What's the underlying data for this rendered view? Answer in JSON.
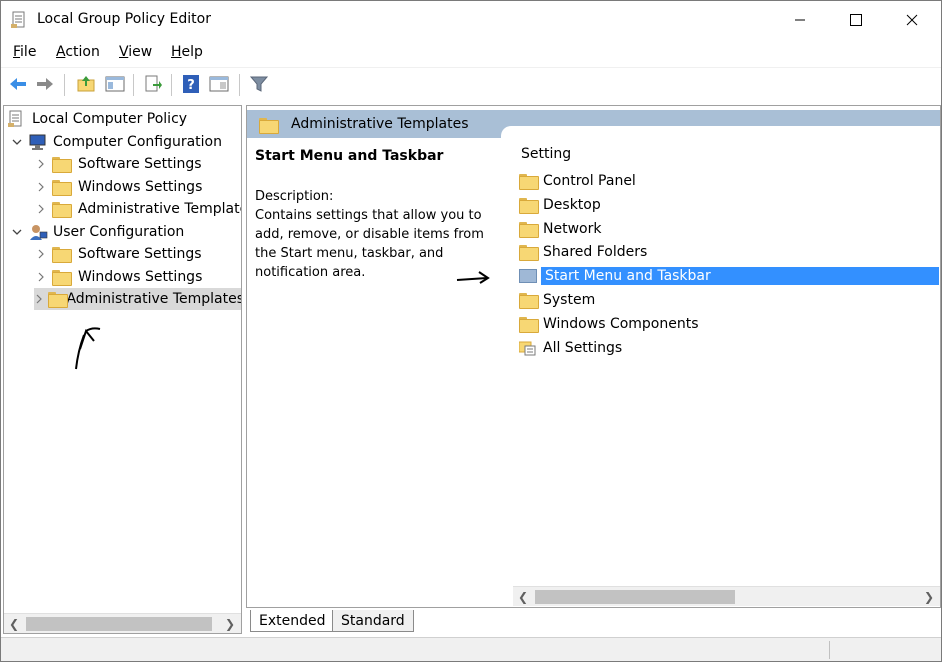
{
  "window": {
    "title": "Local Group Policy Editor",
    "icon": "policy-document-icon"
  },
  "menu": [
    {
      "label": "File"
    },
    {
      "label": "Action"
    },
    {
      "label": "View"
    },
    {
      "label": "Help"
    }
  ],
  "toolbar": {
    "buttons": [
      "back-arrow-icon",
      "forward-arrow-icon",
      "up-folder-icon",
      "show-hide-tree-icon",
      "export-list-icon",
      "help-icon",
      "extended-view-icon",
      "filter-icon"
    ]
  },
  "tree": {
    "root": "Local Computer Policy",
    "computer_config": "Computer Configuration",
    "cc_software": "Software Settings",
    "cc_windows": "Windows Settings",
    "cc_admin": "Administrative Templates",
    "user_config": "User Configuration",
    "uc_software": "Software Settings",
    "uc_windows": "Windows Settings",
    "uc_admin": "Administrative Templates"
  },
  "right": {
    "header_title": "Administrative Templates",
    "selected_title": "Start Menu and Taskbar",
    "description_label": "Description:",
    "description_body": "Contains settings that allow you to add, remove, or disable items from the Start menu, taskbar, and notification area.",
    "column_header": "Setting",
    "settings": [
      "Control Panel",
      "Desktop",
      "Network",
      "Shared Folders",
      "Start Menu and Taskbar",
      "System",
      "Windows Components",
      "All Settings"
    ]
  },
  "tabs": {
    "extended": "Extended",
    "standard": "Standard"
  },
  "colors": {
    "selection": "#3390ff",
    "header_band": "#a9bfd6",
    "folder": "#f7d774"
  }
}
